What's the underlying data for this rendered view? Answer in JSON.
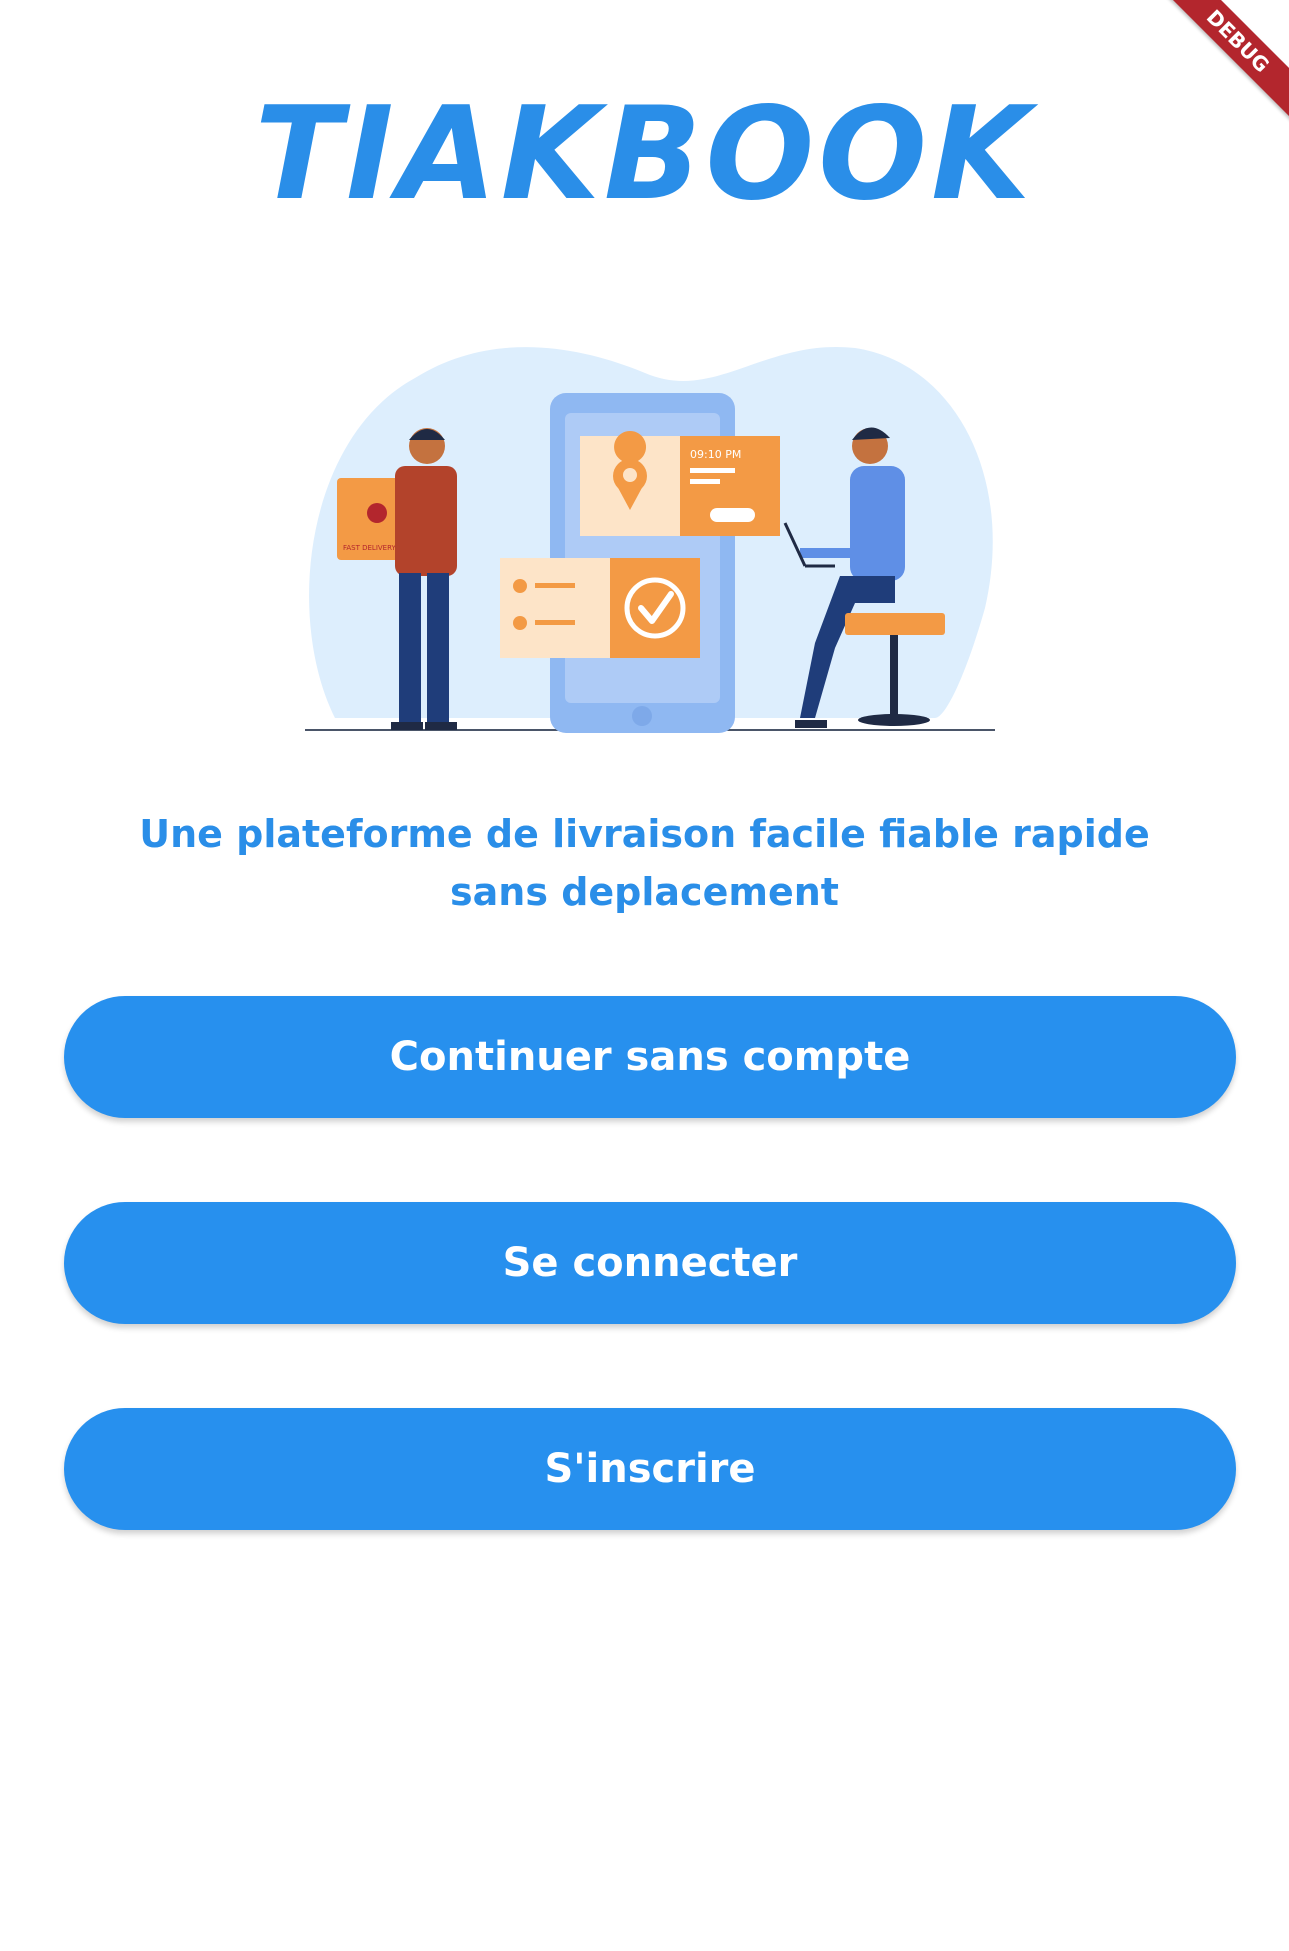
{
  "app": {
    "logo_text": "TIAKBOOK",
    "tagline": "Une plateforme de livraison facile fiable rapide sans deplacement"
  },
  "illustration": {
    "phone_time": "09:10 PM",
    "box_label": "FAST DELIVERY"
  },
  "buttons": {
    "continue_label": "Continuer sans compte",
    "login_label": "Se connecter",
    "signup_label": "S'inscrire"
  },
  "debug_banner": "DEBUG",
  "colors": {
    "primary": "#2790EE",
    "accent": "#F39A45",
    "background": "#FFFFFF"
  }
}
